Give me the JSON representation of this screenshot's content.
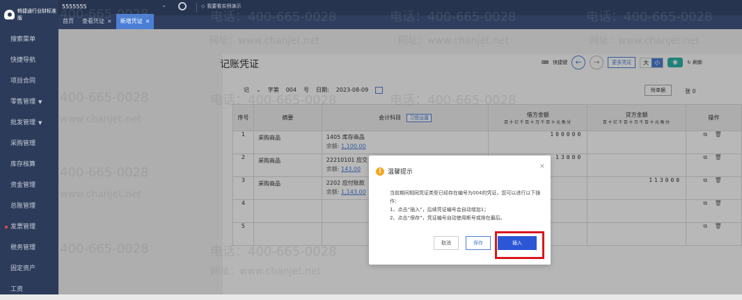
{
  "sidebar": {
    "logo_text": "畅捷通行业财标准版",
    "items": [
      {
        "label": "搜索菜单"
      },
      {
        "label": "快捷导航"
      },
      {
        "label": "项目合同"
      },
      {
        "label": "零售管理",
        "caret": "▼"
      },
      {
        "label": "批发管理",
        "caret": "▼"
      },
      {
        "label": "采购管理"
      },
      {
        "label": "库存核算"
      },
      {
        "label": "资金管理"
      },
      {
        "label": "总账管理"
      },
      {
        "label": "发票管理"
      },
      {
        "label": "税务管理"
      },
      {
        "label": "固定资产"
      },
      {
        "label": "工资"
      }
    ]
  },
  "topbar": {
    "company": "5555555",
    "case_label": "我要看实例演示",
    "tabs": [
      {
        "label": "首页",
        "closable": false
      },
      {
        "label": "查看凭证",
        "closable": true
      },
      {
        "label": "新增凭证",
        "closable": true
      }
    ],
    "close_glyph": "×"
  },
  "page": {
    "title": "记账凭证",
    "shortcut_label": "快捷键",
    "more_voucher": "更多凭证",
    "size_big": "大",
    "size_small": "小",
    "refresh": "刷新",
    "attach": "附单据",
    "zhang": "张",
    "zhang_count": "0"
  },
  "voucher": {
    "ji": "记",
    "word": "字第",
    "number": "004",
    "hao": "号",
    "date_label": "日期:",
    "date": "2023-08-09"
  },
  "table": {
    "headers": {
      "idx": "序号",
      "summary": "摘要",
      "account": "会计科目",
      "habit": "习惯设置",
      "debit": "借方金额",
      "credit": "贷方金额",
      "ops": "操作",
      "digits": "百十亿千百十万千百十元角分"
    },
    "rows": [
      {
        "idx": "1",
        "summary": "采购商品",
        "account": "1405 库存商品",
        "balance_label": "余额:",
        "balance": "1,100.00",
        "debit": "100000",
        "credit": ""
      },
      {
        "idx": "2",
        "summary": "采购商品",
        "account": "22210101 应交",
        "balance_label": "余额:",
        "balance": "143.00",
        "debit": "13000",
        "credit": ""
      },
      {
        "idx": "3",
        "summary": "采购商品",
        "account": "2202 应付账款",
        "balance_label": "余额:",
        "balance": "1,143.00",
        "debit": "",
        "credit": "113000"
      },
      {
        "idx": "4",
        "summary": "",
        "account": "",
        "balance_label": "",
        "balance": "",
        "debit": "",
        "credit": ""
      },
      {
        "idx": "5",
        "summary": "",
        "account": "",
        "balance_label": "",
        "balance": "",
        "debit": "",
        "credit": ""
      }
    ],
    "ops_icons": "⧉ 🗑"
  },
  "dialog": {
    "title": "温馨提示",
    "icon": "!",
    "body_line1": "当前期间相同凭证类型已经存在编号为004的凭证，您可以进行以下操作：",
    "body_line2": "1、点击“插入”，后续凭证编号会自动增加1；",
    "body_line3": "2、点击“保存”，凭证编号自动使用断号或排在最后。",
    "cancel": "取消",
    "save": "保存",
    "insert": "插入"
  },
  "watermark": {
    "phone": "电话：400-665-0028",
    "site": "网址：www.chanjet.net",
    "phone_short": "400-665-0028",
    "site_short": "www.chanjet.net"
  },
  "colors": {
    "sidebar": "#2c3b5a",
    "accent": "#4b7fd6",
    "primary_button": "#2b56d6",
    "highlight": "#d8161c"
  }
}
